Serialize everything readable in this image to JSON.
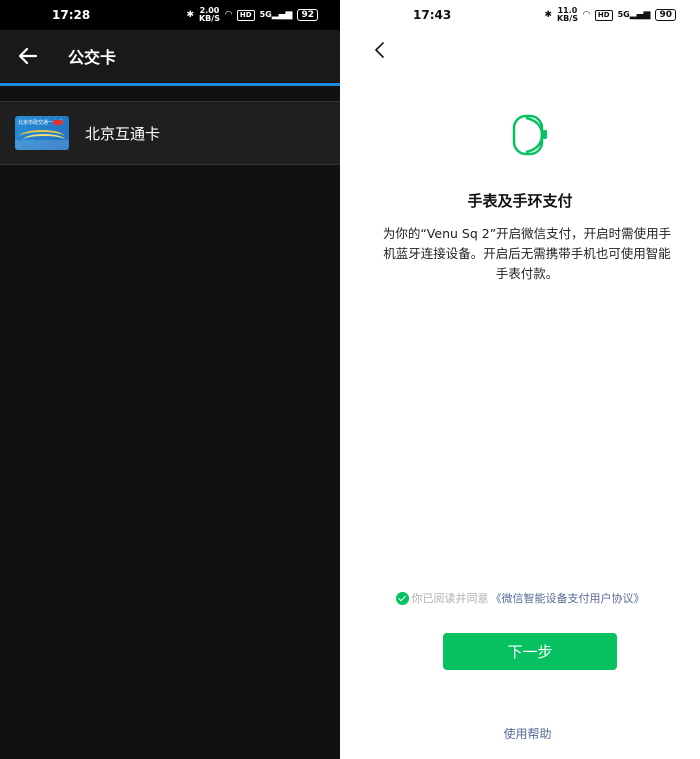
{
  "left": {
    "status": {
      "time": "17:28",
      "speed": "2.00",
      "speed_unit": "KB/S",
      "hd": "HD",
      "net": "5G",
      "battery": "92"
    },
    "appbar": {
      "title": "公交卡"
    },
    "cards": [
      {
        "name": "北京互通卡",
        "card_text": "北京市政交通一卡通"
      }
    ]
  },
  "right": {
    "status": {
      "time": "17:43",
      "speed": "11.0",
      "speed_unit": "KB/S",
      "hd": "HD",
      "net": "5G",
      "battery": "90"
    },
    "title": "手表及手环支付",
    "description": "为你的“Venu Sq 2”开启微信支付，开启时需使用手机蓝牙连接设备。开启后无需携带手机也可使用智能手表付款。",
    "agreement_prefix": "你已阅读并同意",
    "agreement_link": "《微信智能设备支付用户协议》",
    "next_button": "下一步",
    "help_link": "使用帮助"
  },
  "colors": {
    "wechat_green": "#07c160",
    "link_blue": "#576b95",
    "accent_blue": "#1a8cdb"
  }
}
